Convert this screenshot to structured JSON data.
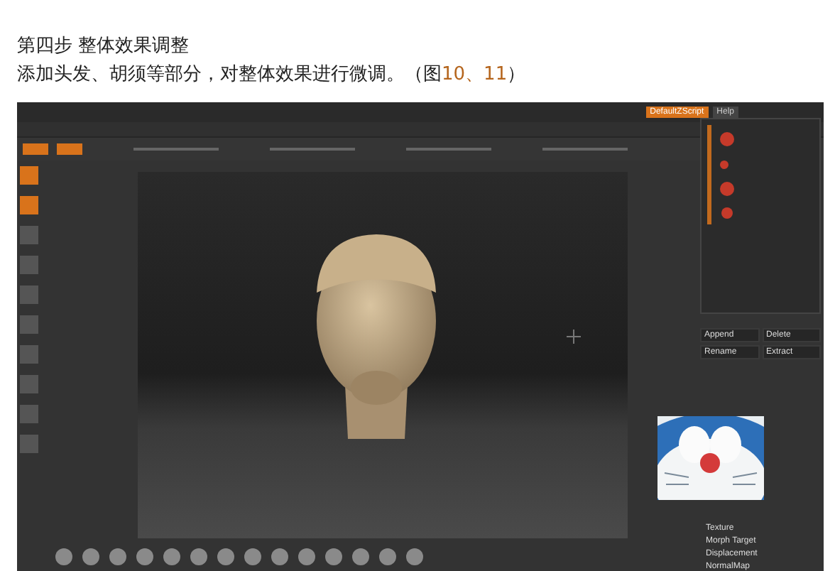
{
  "article": {
    "heading": "第四步 整体效果调整",
    "paragraph": {
      "text": "添加头发、胡须等部分，对整体效果进行微调。（图",
      "link": "10、11",
      "after": "）"
    }
  },
  "screenshot": {
    "header_buttons": [
      {
        "label": "DefaultZScript",
        "selected": true
      },
      {
        "label": "Help",
        "selected": false
      }
    ],
    "subtool_buttons": [
      "Append",
      "Delete",
      "Rename",
      "Extract"
    ],
    "panel_items": [
      "Texture",
      "Morph Target",
      "Displacement",
      "NormalMap"
    ]
  }
}
